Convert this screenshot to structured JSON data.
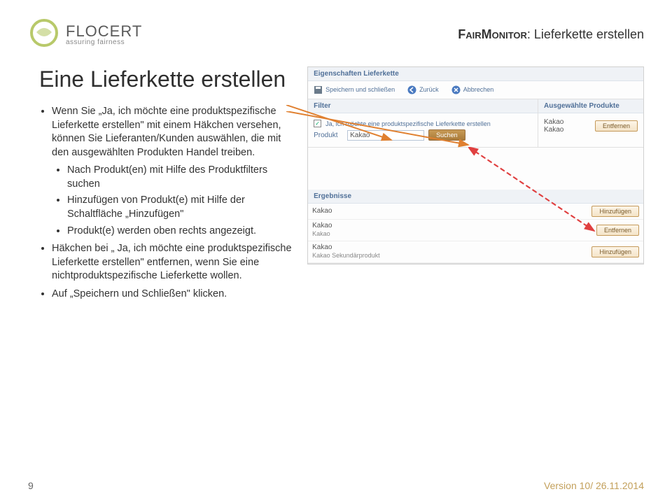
{
  "header": {
    "logo_name": "FLOCERT",
    "logo_tag": "assuring fairness",
    "doc_title_sc": "FairMonitor",
    "doc_title_rest": ": Lieferkette erstellen"
  },
  "title": "Eine Lieferkette erstellen",
  "bullets": {
    "b1": "Wenn Sie „Ja, ich möchte eine produktspezifische Lieferkette erstellen\" mit einem Häkchen versehen, können Sie Lieferanten/Kunden auswählen, die mit den ausgewählten Produkten Handel treiben.",
    "b1s1": "Nach Produkt(en) mit Hilfe des Produktfilters  suchen",
    "b1s2": "Hinzufügen von Produkt(e) mit Hilfe der Schaltfläche „Hinzufügen\"",
    "b1s3": "Produkt(e) werden oben rechts angezeigt.",
    "b2": "Häkchen bei „ Ja, ich möchte eine produktspezifische Lieferkette erstellen\" entfernen, wenn Sie eine nichtproduktspezifische Lieferkette wollen.",
    "b3": "Auf „Speichern und Schließen\" klicken."
  },
  "sc": {
    "sec1": "Eigenschaften Lieferkette",
    "tb_save": "Speichern und schließen",
    "tb_back": "Zurück",
    "tb_cancel": "Abbrechen",
    "filter": "Filter",
    "selected": "Ausgewählte Produkte",
    "check_label": "Ja, ich möchte eine produktspezifische Lieferkette erstellen",
    "prod_label": "Produkt",
    "prod_val": "Kakao",
    "btn_search": "Suchen",
    "btn_remove": "Entfernen",
    "btn_add": "Hinzufügen",
    "sel_items": [
      "Kakao",
      "Kakao"
    ],
    "results_hdr": "Ergebnisse",
    "res": [
      {
        "t": "Kakao",
        "sub": "",
        "act": "Hinzufügen"
      },
      {
        "t": "Kakao",
        "sub": "Kakao",
        "act": "Entfernen"
      },
      {
        "t": "Kakao",
        "sub": "Kakao Sekundärprodukt",
        "act": "Hinzufügen"
      }
    ]
  },
  "footer": {
    "page": "9",
    "version": "Version 10/ 26.11.2014"
  }
}
